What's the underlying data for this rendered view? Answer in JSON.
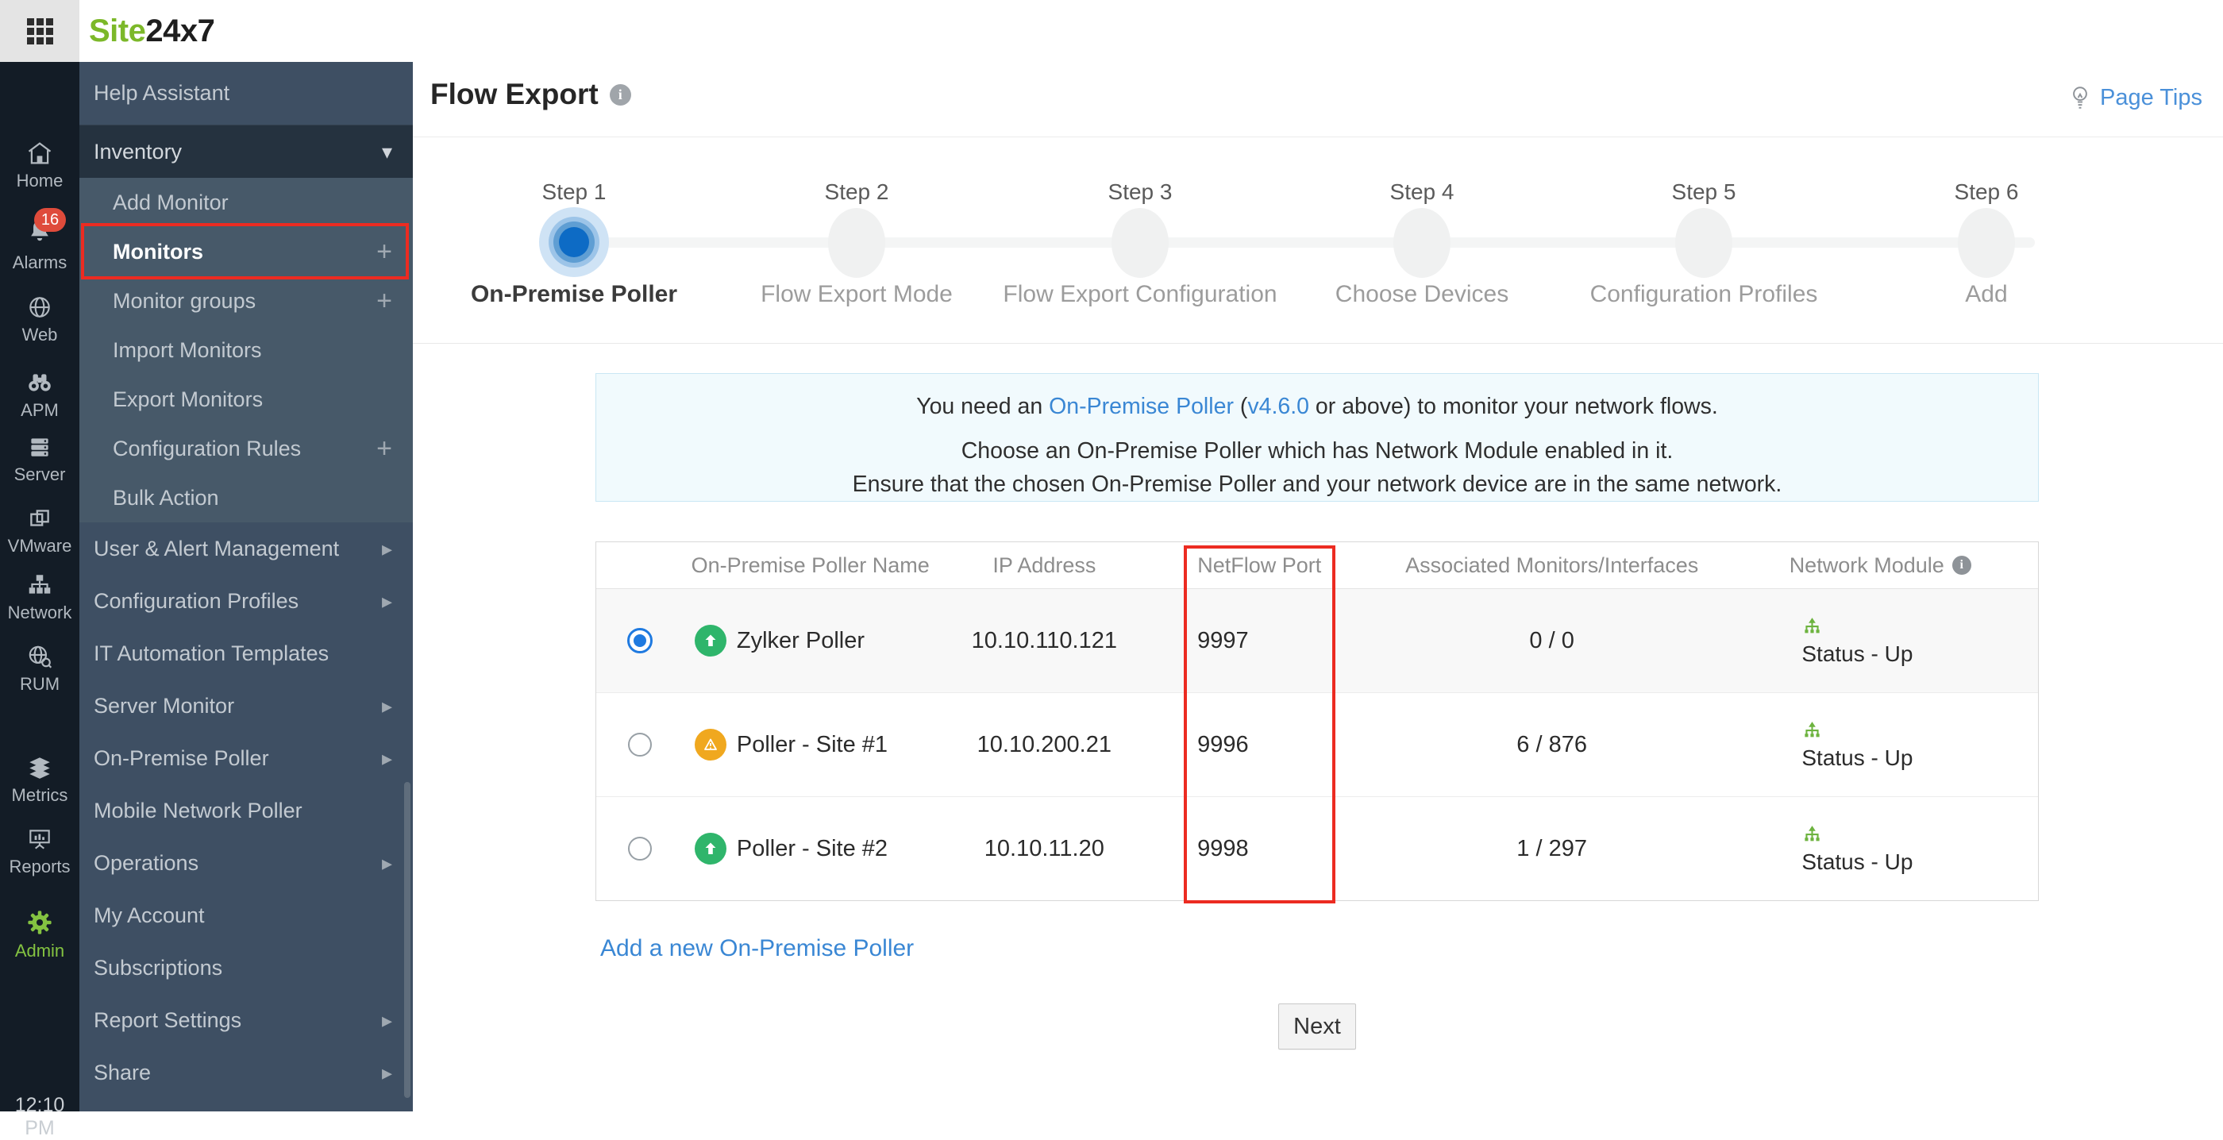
{
  "topbar": {
    "brand_green": "Site",
    "brand_dark": "24x7"
  },
  "rail": {
    "time": "12:10 PM",
    "alarms_badge": "16",
    "items": [
      {
        "label": "Home",
        "icon": "home-icon"
      },
      {
        "label": "Alarms",
        "icon": "bell-icon"
      },
      {
        "label": "Web",
        "icon": "globe-icon"
      },
      {
        "label": "APM",
        "icon": "binoculars-icon"
      },
      {
        "label": "Server",
        "icon": "server-icon"
      },
      {
        "label": "VMware",
        "icon": "vmware-icon"
      },
      {
        "label": "Network",
        "icon": "network-icon"
      },
      {
        "label": "RUM",
        "icon": "rum-icon"
      },
      {
        "label": "Metrics",
        "icon": "layers-icon"
      },
      {
        "label": "Reports",
        "icon": "presentation-icon"
      },
      {
        "label": "Admin",
        "icon": "gear-icon",
        "active": true
      }
    ]
  },
  "sidebar": {
    "items": [
      {
        "label": "Help Assistant"
      },
      {
        "label": "Inventory",
        "expanded": true
      },
      {
        "label": "Add Monitor"
      },
      {
        "label": "Monitors",
        "has_plus": true,
        "current": true
      },
      {
        "label": "Monitor groups",
        "has_plus": true
      },
      {
        "label": "Import Monitors"
      },
      {
        "label": "Export Monitors"
      },
      {
        "label": "Configuration Rules",
        "has_plus": true
      },
      {
        "label": "Bulk Action"
      },
      {
        "label": "User & Alert Management",
        "has_arrow": true
      },
      {
        "label": "Configuration Profiles",
        "has_arrow": true
      },
      {
        "label": "IT Automation Templates"
      },
      {
        "label": "Server Monitor",
        "has_arrow": true
      },
      {
        "label": "On-Premise Poller",
        "has_arrow": true
      },
      {
        "label": "Mobile Network Poller"
      },
      {
        "label": "Operations",
        "has_arrow": true
      },
      {
        "label": "My Account"
      },
      {
        "label": "Subscriptions"
      },
      {
        "label": "Report Settings",
        "has_arrow": true
      },
      {
        "label": "Share",
        "has_arrow": true
      }
    ]
  },
  "main": {
    "title": "Flow Export",
    "page_tips": "Page Tips",
    "wizard": {
      "steps": [
        {
          "step": "Step 1",
          "name": "On-Premise Poller",
          "active": true
        },
        {
          "step": "Step 2",
          "name": "Flow Export Mode"
        },
        {
          "step": "Step 3",
          "name": "Flow Export Configuration"
        },
        {
          "step": "Step 4",
          "name": "Choose Devices"
        },
        {
          "step": "Step 5",
          "name": "Configuration Profiles"
        },
        {
          "step": "Step 6",
          "name": "Add"
        }
      ]
    },
    "notice": {
      "l1a": "You need an ",
      "l1_link1": "On-Premise Poller",
      "l1b": " (",
      "l1_link2": "v4.6.0",
      "l1c": " or above) to monitor your network flows.",
      "l2": "Choose an On-Premise Poller which has Network Module enabled in it.",
      "l3": "Ensure that the chosen On-Premise Poller and your network device are in the same network."
    },
    "table": {
      "headers": [
        "On-Premise Poller Name",
        "IP Address",
        "NetFlow Port",
        "Associated Monitors/Interfaces",
        "Network Module"
      ],
      "rows": [
        {
          "name": "Zylker Poller",
          "ip": "10.10.110.121",
          "port": "9997",
          "monitors": "0 / 0",
          "status": "Status - Up",
          "health": "up",
          "selected": true
        },
        {
          "name": "Poller - Site #1",
          "ip": "10.10.200.21",
          "port": "9996",
          "monitors": "6 / 876",
          "status": "Status - Up",
          "health": "warning",
          "selected": false
        },
        {
          "name": "Poller - Site #2",
          "ip": "10.10.11.20",
          "port": "9998",
          "monitors": "1 / 297",
          "status": "Status - Up",
          "health": "up",
          "selected": false
        }
      ]
    },
    "add_poller_link": "Add a new On-Premise Poller",
    "next_label": "Next"
  },
  "colors": {
    "brand_green": "#7cb829",
    "accent_blue": "#1f7ae0",
    "link_blue": "#3a87d4",
    "success_green": "#2fb56b",
    "warning_orange": "#f0a81f",
    "module_green": "#6db33f",
    "annotation_red": "#ec2b21"
  }
}
